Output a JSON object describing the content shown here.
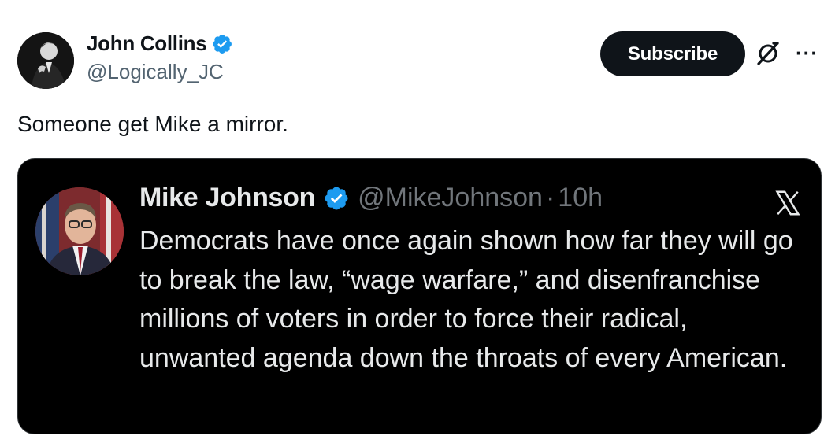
{
  "author": {
    "name": "John Collins",
    "handle": "@Logically_JC"
  },
  "actions": {
    "subscribe_label": "Subscribe",
    "grok_icon": "grok-icon",
    "more_icon": "more-icon",
    "more_glyph": "···"
  },
  "tweet": {
    "text": "Someone get Mike a mirror."
  },
  "quoted": {
    "name": "Mike Johnson",
    "handle": "@MikeJohnson",
    "separator": "·",
    "time": "10h",
    "text": "Democrats have once again shown how far they will go to break the law, “wage warfare,” and disenfranchise millions of voters in order to force their radical, unwanted agenda down the throats of every American."
  },
  "colors": {
    "verified_blue": "#1d9bf0",
    "button_bg": "#0f1419",
    "card_bg": "#000000",
    "muted": "#536471"
  }
}
